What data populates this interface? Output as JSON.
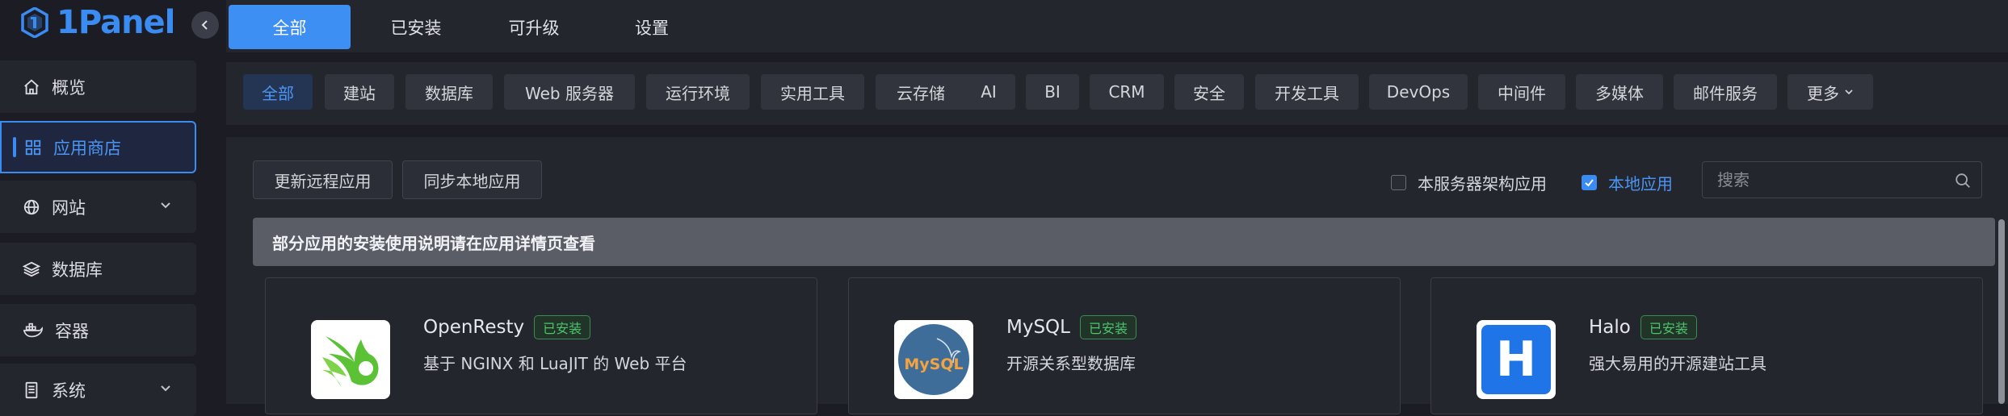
{
  "sidebar": {
    "logo_text": "1Panel",
    "items": [
      {
        "label": "概览",
        "icon": "home-icon"
      },
      {
        "label": "应用商店",
        "icon": "grid-icon",
        "active": true
      },
      {
        "label": "网站",
        "icon": "globe-icon",
        "expandable": true
      },
      {
        "label": "数据库",
        "icon": "layers-icon"
      },
      {
        "label": "容器",
        "icon": "docker-icon"
      },
      {
        "label": "系统",
        "icon": "server-icon",
        "expandable": true
      }
    ]
  },
  "tabs": [
    {
      "label": "全部",
      "active": true
    },
    {
      "label": "已安装"
    },
    {
      "label": "可升级"
    },
    {
      "label": "设置"
    }
  ],
  "categories": [
    {
      "label": "全部",
      "active": true
    },
    {
      "label": "建站"
    },
    {
      "label": "数据库"
    },
    {
      "label": "Web 服务器"
    },
    {
      "label": "运行环境"
    },
    {
      "label": "实用工具"
    },
    {
      "label": "云存储"
    },
    {
      "label": "AI"
    },
    {
      "label": "BI"
    },
    {
      "label": "CRM"
    },
    {
      "label": "安全"
    },
    {
      "label": "开发工具"
    },
    {
      "label": "DevOps"
    },
    {
      "label": "中间件"
    },
    {
      "label": "多媒体"
    },
    {
      "label": "邮件服务"
    },
    {
      "label": "更多"
    }
  ],
  "toolbar": {
    "update_remote": "更新远程应用",
    "sync_local": "同步本地应用",
    "arch_filter": {
      "label": "本服务器架构应用",
      "checked": false
    },
    "local_filter": {
      "label": "本地应用",
      "checked": true
    },
    "search_placeholder": "搜索"
  },
  "notice": "部分应用的安装使用说明请在应用详情页查看",
  "apps": [
    {
      "name": "OpenResty",
      "status": "已安装",
      "description": "基于 NGINX 和 LuaJIT 的 Web 平台"
    },
    {
      "name": "MySQL",
      "status": "已安装",
      "description": "开源关系型数据库",
      "logo_text": "MySQL"
    },
    {
      "name": "Halo",
      "status": "已安装",
      "description": "强大易用的开源建站工具",
      "logo_text": "H"
    }
  ],
  "colors": {
    "accent": "#3a8bf2",
    "installed_badge": "#4fc36e",
    "background": "#1c1d24",
    "panel": "#24262e"
  }
}
